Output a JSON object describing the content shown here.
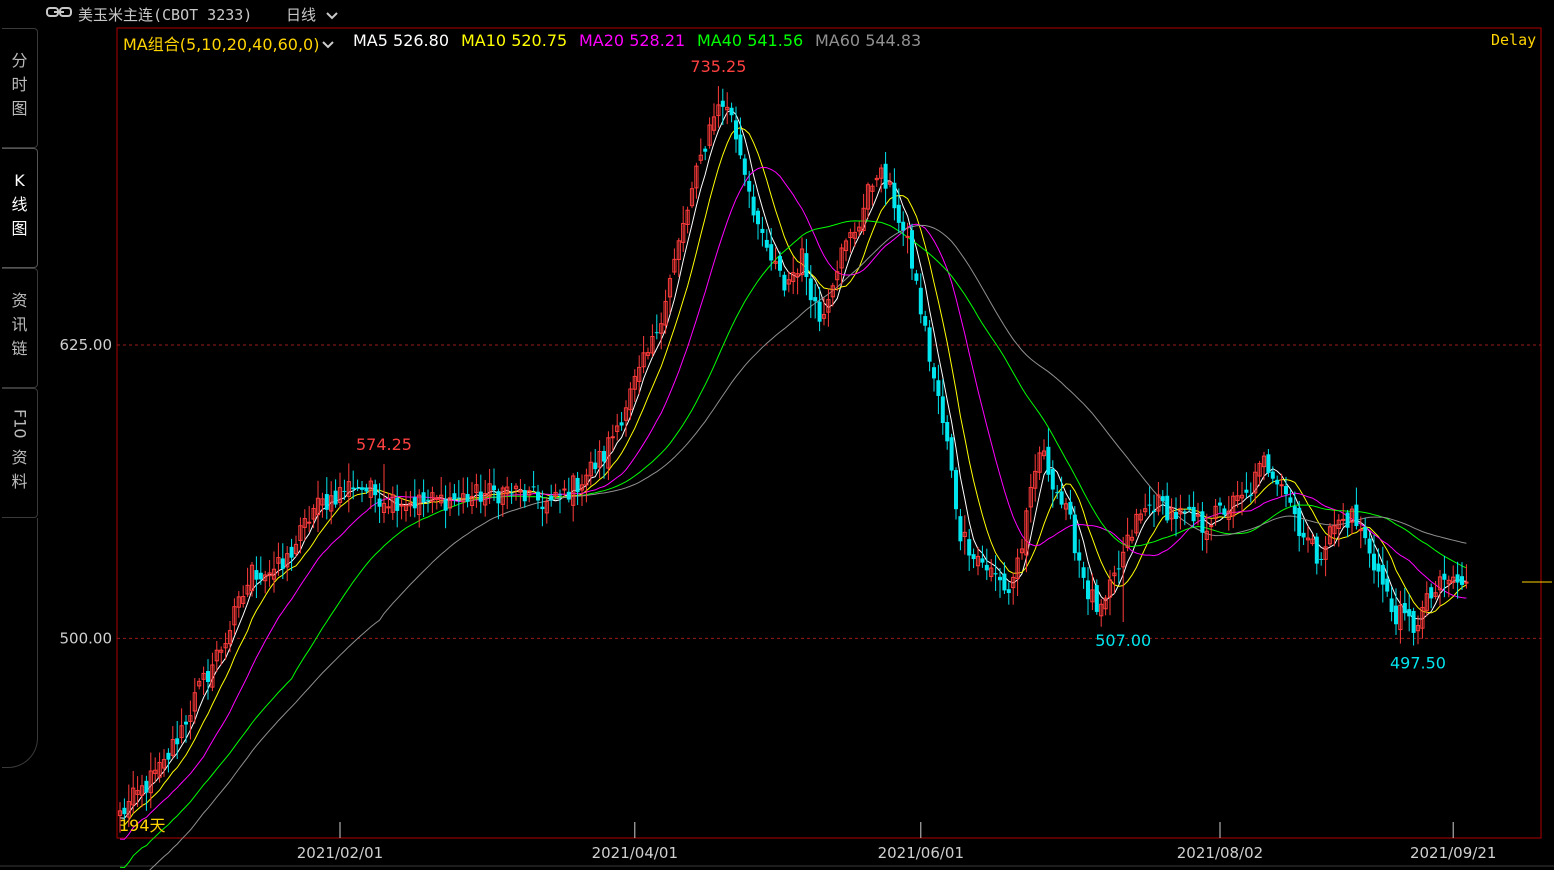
{
  "header": {
    "instrument": "美玉米主连(CBOT 3233)",
    "period": "日线",
    "delay": "Delay"
  },
  "sidebar": {
    "tabs": [
      {
        "label": "分时图",
        "active": false
      },
      {
        "label": "K线图",
        "active": true
      },
      {
        "label": "资讯链",
        "active": false
      },
      {
        "label": "F10资料",
        "active": false
      }
    ]
  },
  "legend": {
    "group": "MA组合(5,10,20,40,60,0)",
    "items": [
      {
        "label": "MA5 526.80",
        "color": "#ffffff"
      },
      {
        "label": "MA10 520.75",
        "color": "#ffff00"
      },
      {
        "label": "MA20 528.21",
        "color": "#ff00ff"
      },
      {
        "label": "MA40 541.56",
        "color": "#00ff00"
      },
      {
        "label": "MA60 544.83",
        "color": "#909090"
      }
    ]
  },
  "colors": {
    "up": "#ff3b3b",
    "down": "#00e5ee",
    "frame": "#b00000",
    "grid": "#9a1c1c"
  },
  "chart_data": {
    "type": "candlestick",
    "x_ticks": [
      "2021/02/01",
      "2021/04/01",
      "2021/06/01",
      "2021/08/02",
      "2021/09/21"
    ],
    "y_ticks": [
      500,
      625
    ],
    "ylim": [
      415,
      760
    ],
    "annotations": [
      {
        "label": "735.25",
        "value": 735.25,
        "kind": "high",
        "date": "2021/05/07"
      },
      {
        "label": "574.25",
        "value": 574.25,
        "kind": "high",
        "date": "2021/02/25"
      },
      {
        "label": "507.00",
        "value": 507.0,
        "kind": "low",
        "date": "2021/07/26"
      },
      {
        "label": "497.50",
        "value": 497.5,
        "kind": "low",
        "date": "2021/09/10"
      }
    ],
    "days_label": "194天",
    "anchor_points": [
      [
        0,
        425
      ],
      [
        10,
        446
      ],
      [
        18,
        478
      ],
      [
        24,
        500
      ],
      [
        30,
        528
      ],
      [
        37,
        530
      ],
      [
        44,
        555
      ],
      [
        53,
        566
      ],
      [
        60,
        560
      ],
      [
        68,
        558
      ],
      [
        78,
        560
      ],
      [
        88,
        563
      ],
      [
        98,
        557
      ],
      [
        105,
        568
      ],
      [
        110,
        578
      ],
      [
        115,
        600
      ],
      [
        121,
        625
      ],
      [
        126,
        660
      ],
      [
        130,
        690
      ],
      [
        135,
        725
      ],
      [
        138,
        728
      ],
      [
        142,
        700
      ],
      [
        146,
        668
      ],
      [
        151,
        650
      ],
      [
        155,
        662
      ],
      [
        159,
        636
      ],
      [
        163,
        660
      ],
      [
        168,
        678
      ],
      [
        172,
        700
      ],
      [
        176,
        686
      ],
      [
        180,
        660
      ],
      [
        184,
        620
      ],
      [
        188,
        582
      ],
      [
        191,
        545
      ],
      [
        195,
        535
      ],
      [
        198,
        528
      ],
      [
        202,
        520
      ],
      [
        205,
        540
      ],
      [
        209,
        580
      ],
      [
        212,
        568
      ],
      [
        216,
        548
      ],
      [
        220,
        520
      ],
      [
        223,
        510
      ],
      [
        227,
        530
      ],
      [
        231,
        550
      ],
      [
        235,
        558
      ],
      [
        240,
        553
      ],
      [
        246,
        548
      ],
      [
        251,
        555
      ],
      [
        256,
        560
      ],
      [
        260,
        575
      ],
      [
        264,
        568
      ],
      [
        268,
        548
      ],
      [
        272,
        535
      ],
      [
        276,
        548
      ],
      [
        280,
        552
      ],
      [
        284,
        538
      ],
      [
        289,
        512
      ],
      [
        294,
        505
      ],
      [
        298,
        518
      ],
      [
        302,
        525
      ],
      [
        306,
        522
      ]
    ]
  }
}
